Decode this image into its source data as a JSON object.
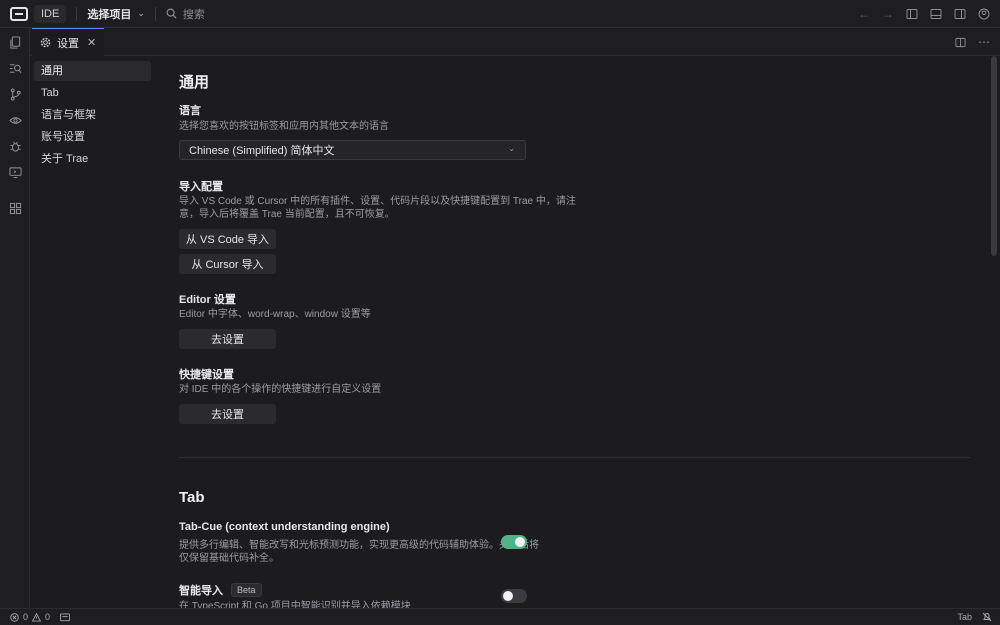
{
  "topbar": {
    "ide_label": "IDE",
    "project_label": "选择项目",
    "search_placeholder": "搜索"
  },
  "tab": {
    "label": "设置"
  },
  "nav": {
    "items": [
      {
        "label": "通用",
        "active": true
      },
      {
        "label": "Tab"
      },
      {
        "label": "语言与框架"
      },
      {
        "label": "账号设置"
      },
      {
        "label": "关于 Trae"
      }
    ]
  },
  "general": {
    "title": "通用",
    "language": {
      "heading": "语言",
      "desc": "选择您喜欢的按钮标签和应用内其他文本的语言",
      "selected": "Chinese (Simplified) 简体中文"
    },
    "import": {
      "heading": "导入配置",
      "desc_line1": "导入 VS Code 或 Cursor 中的所有插件、设置、代码片段以及快捷键配置到 Trae 中，请注",
      "desc_line2": "意，导入后将覆盖 Trae 当前配置，且不可恢复。",
      "vscode_button": "从 VS Code 导入",
      "cursor_button": "从 Cursor 导入"
    },
    "editor": {
      "heading": "Editor 设置",
      "desc": "Editor 中字体、word-wrap、window 设置等",
      "button": "去设置"
    },
    "shortcuts": {
      "heading": "快捷键设置",
      "desc": "对 IDE 中的各个操作的快捷键进行自定义设置",
      "button": "去设置"
    }
  },
  "tab_section": {
    "title": "Tab",
    "tab_cue": {
      "heading": "Tab-Cue (context understanding engine)",
      "desc_line1": "提供多行编辑、智能改写和光标预测功能，实现更高级的代码辅助体验。关闭后将",
      "desc_line2": "仅保留基础代码补全。",
      "enabled": true
    },
    "smart_import": {
      "heading": "智能导入",
      "badge": "Beta",
      "desc_line1": "在 TypeScript 和 Go 项目中智能识别并导入依赖模块",
      "enabled": false
    }
  },
  "statusbar": {
    "errors": "0",
    "warnings": "0",
    "right_label": "Tab"
  },
  "colors": {
    "accent_tab_border": "#5a8cf0",
    "toggle_on": "#4fb38a",
    "toggle_off": "#3c3c40",
    "background": "#1c1c1e"
  }
}
